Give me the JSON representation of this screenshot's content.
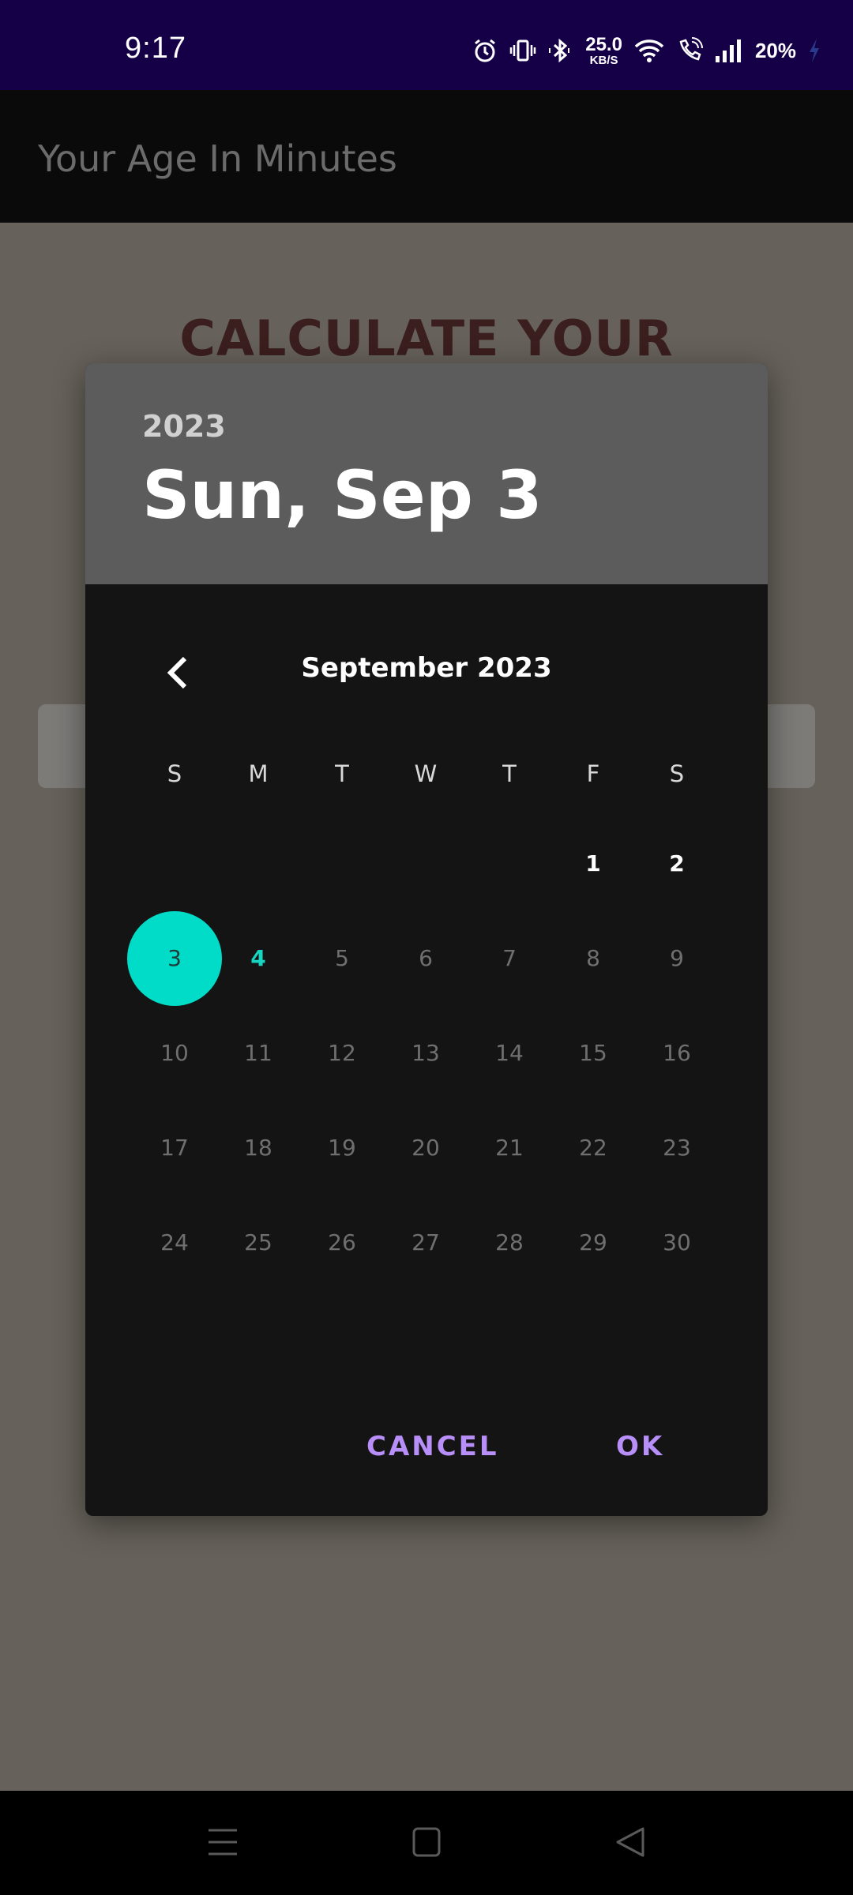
{
  "status_bar": {
    "time": "9:17",
    "net_speed_value": "25.0",
    "net_speed_unit": "KB/S",
    "battery": "20%",
    "icons": [
      "alarm-icon",
      "vibrate-icon",
      "bluetooth-icon",
      "wifi-icon",
      "wifi-call-icon",
      "signal-icon",
      "battery-charging-icon"
    ]
  },
  "app_bar": {
    "title": "Your Age In Minutes"
  },
  "background": {
    "heading": "CALCULATE YOUR"
  },
  "date_picker": {
    "year": "2023",
    "selected_date_label": "Sun, Sep 3",
    "month_label": "September 2023",
    "weekdays": [
      "S",
      "M",
      "T",
      "W",
      "T",
      "F",
      "S"
    ],
    "weeks": [
      [
        "",
        "",
        "",
        "",
        "",
        "1",
        "2"
      ],
      [
        "3",
        "4",
        "5",
        "6",
        "7",
        "8",
        "9"
      ],
      [
        "10",
        "11",
        "12",
        "13",
        "14",
        "15",
        "16"
      ],
      [
        "17",
        "18",
        "19",
        "20",
        "21",
        "22",
        "23"
      ],
      [
        "24",
        "25",
        "26",
        "27",
        "28",
        "29",
        "30"
      ]
    ],
    "selected_day": "3",
    "today_day": "4",
    "enabled_days": [
      "1",
      "2",
      "3"
    ],
    "cancel_label": "CANCEL",
    "ok_label": "OK",
    "colors": {
      "selected_circle": "#00dcc8",
      "today_text": "#16d6c2",
      "button_text": "#b88ef8",
      "header_bg": "#5c5c5c",
      "body_bg": "#141414"
    }
  },
  "nav_bar": {
    "icons": [
      "menu-icon",
      "home-square-icon",
      "back-triangle-icon"
    ]
  }
}
